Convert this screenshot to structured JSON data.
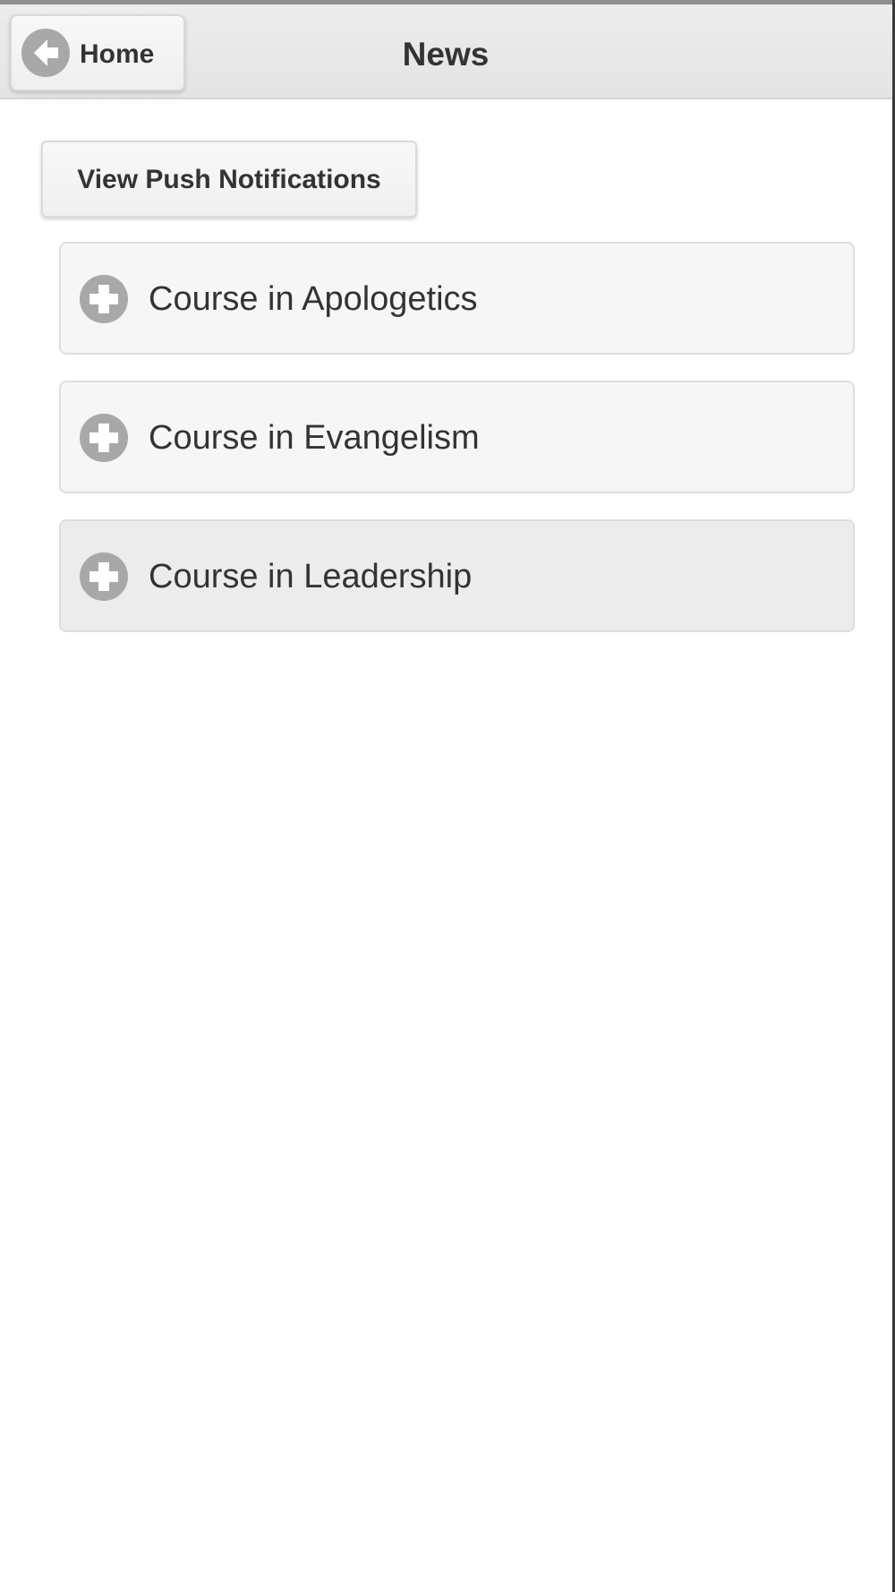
{
  "header": {
    "back_label": "Home",
    "title": "News",
    "back_icon": "arrow-left-circle-icon"
  },
  "main": {
    "push_button_label": "View Push Notifications",
    "courses": [
      {
        "label": "Course in Apologetics",
        "icon": "plus-circle-icon",
        "expanded": false
      },
      {
        "label": "Course in Evangelism",
        "icon": "plus-circle-icon",
        "expanded": false
      },
      {
        "label": "Course in Leadership",
        "icon": "plus-circle-icon",
        "expanded": false
      }
    ]
  },
  "colors": {
    "header_bg": "#e8e8e8",
    "button_bg": "#f6f6f6",
    "icon_gray": "#a8a8a8",
    "text": "#333333",
    "page_bg": "#ffffff"
  }
}
